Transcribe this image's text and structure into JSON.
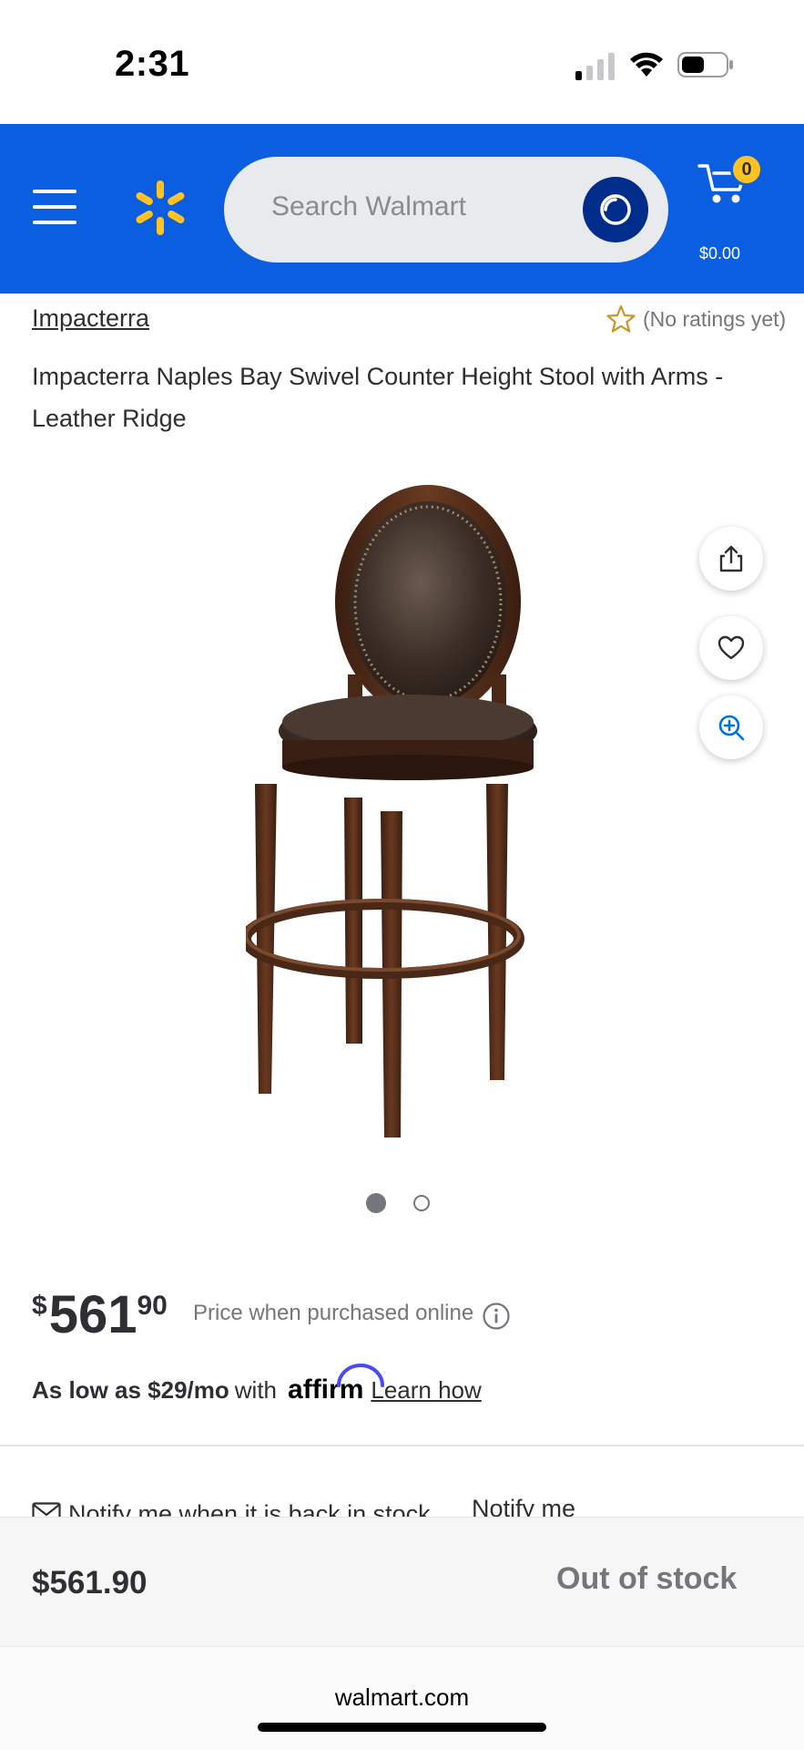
{
  "status_bar": {
    "time": "2:31"
  },
  "header": {
    "search_placeholder": "Search Walmart",
    "cart_count": "0",
    "cart_total": "$0.00",
    "brand_color": "#0b5ee0",
    "spark_color": "#ffc220"
  },
  "product": {
    "brand": "Impacterra",
    "rating_text": "(No ratings yet)",
    "title": "Impacterra Naples Bay Swivel Counter Height Stool with Arms - Leather Ridge",
    "image_count": 2,
    "active_image": 1
  },
  "price": {
    "currency": "$",
    "dollars": "561",
    "cents": "90",
    "note": "Price when purchased online"
  },
  "affirm": {
    "strong_text": "As low as $29/mo",
    "with_text": "with",
    "logo_text": "affirm",
    "learn_link": "Learn how"
  },
  "notify": {
    "text": "Notify me when it is back in stock",
    "link": "Notify me"
  },
  "bottom_bar": {
    "price": "$561.90",
    "status": "Out of stock"
  },
  "browser": {
    "url": "walmart.com"
  },
  "icons": {
    "share": "share-icon",
    "favorite": "heart-icon",
    "zoom": "zoom-in-icon",
    "info": "info-icon",
    "mail": "mail-icon",
    "star": "star-outline-icon"
  }
}
